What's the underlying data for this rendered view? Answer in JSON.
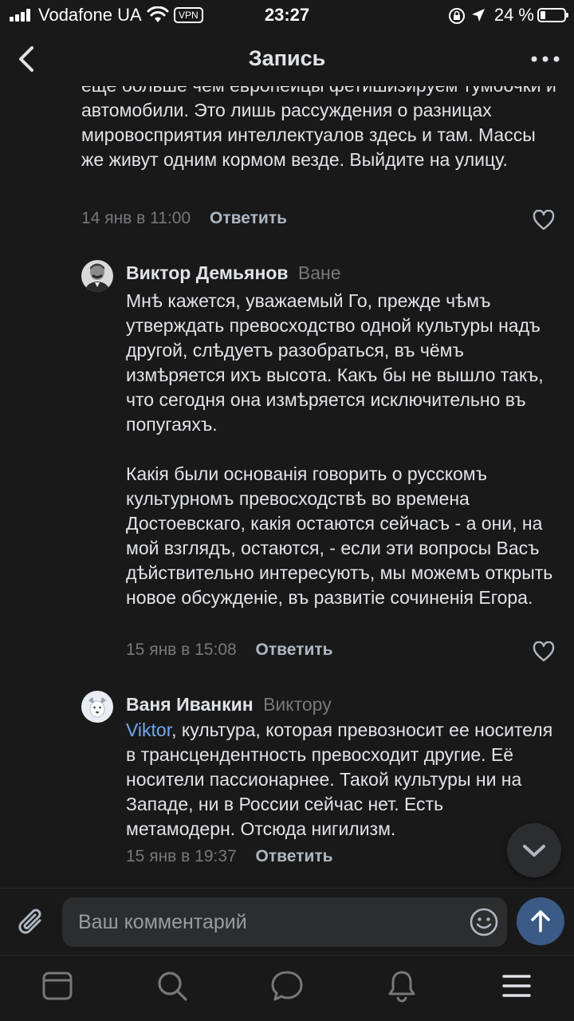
{
  "status": {
    "carrier": "Vodafone UA",
    "vpn": "VPN",
    "time": "23:27",
    "battery": "24 %",
    "battery_level": 0.24
  },
  "header": {
    "title": "Запись"
  },
  "continued_comment": {
    "text": "еще больше чем европейцы фетишизируем тумбочки и автомобили. Это лишь рассуждения о разницах мировосприятия интеллектуалов здесь и там. Массы же живут одним кормом везде. Выйдите на улицу.",
    "date": "14 янв в 11:00",
    "reply_label": "Ответить"
  },
  "comments": [
    {
      "author": "Виктор Демьянов",
      "reply_to": "Ване",
      "text": "Мнѣ кажется, уважаемый Го, прежде чѣмъ утверждать превосходство одной культуры надъ другой, слѣдуетъ разобраться, въ чёмъ измѣряется ихъ высота. Какъ бы не вышло такъ, что сегодня она измѣряется исключительно въ попугаяхъ.\n\nКакія были основанія говорить о русскомъ культурномъ превосходствѣ во времена Достоевскаго, какія остаются сейчасъ - а они, на мой взглядъ, остаются, - если эти вопросы Васъ дѣйствительно интересуютъ, мы можемъ открыть новое обсужденіе, въ развитіе сочиненія Егора.",
      "date": "15 янв в 15:08",
      "reply_label": "Ответить"
    },
    {
      "author": "Ваня Иванкин",
      "reply_to": "Виктору",
      "mention": "Viktor",
      "text": ", культура, которая превозносит ее носителя в трансцендентность превосходит другие. Её носители пассионарнее. Такой культуры ни на Западе, ни в России сейчас нет. Есть метамодерн. Отсюда нигилизм.",
      "date": "15 янв в 19:37",
      "reply_label": "Ответить"
    }
  ],
  "composer": {
    "placeholder": "Ваш комментарий"
  },
  "colors": {
    "background": "#19191a",
    "accent": "#71aaeb",
    "send_button": "#3b5a86",
    "secondary_text": "#76787a"
  },
  "tabbar": {
    "items": [
      "news-icon",
      "search-icon",
      "messages-icon",
      "notifications-icon",
      "menu-icon"
    ]
  }
}
